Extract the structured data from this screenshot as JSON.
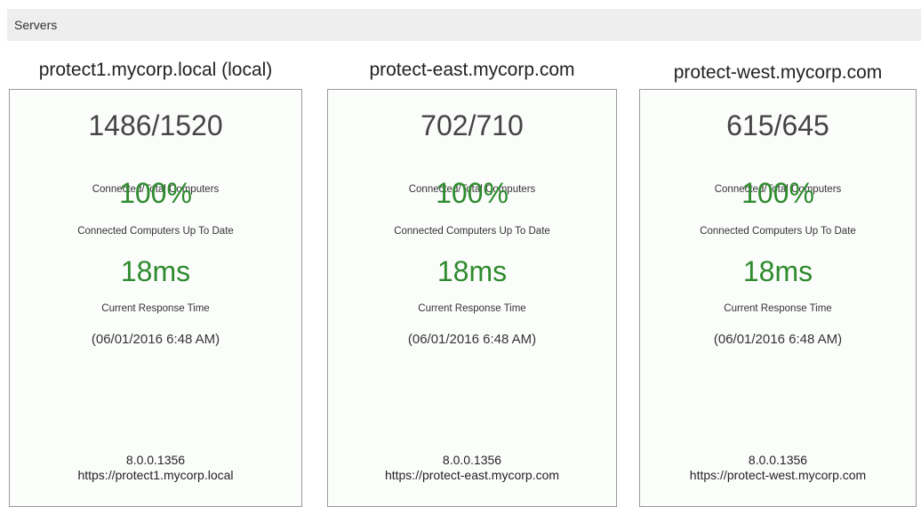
{
  "panel": {
    "title": "Servers"
  },
  "colors": {
    "metric_green": "#2e8b2e",
    "card_border": "#9a9a9a",
    "header_bg": "#eeeeee"
  },
  "servers": [
    {
      "name": "protect1.mycorp.local (local)",
      "connected_total": "1486/1520",
      "connected_total_label": "Connected/Total Computers",
      "up_to_date": "100%",
      "up_to_date_label": "Connected Computers Up To Date",
      "response_time": "18ms",
      "response_time_label": "Current Response Time",
      "timestamp": "(06/01/2016 6:48 AM)",
      "version": "8.0.0.1356",
      "url": "https://protect1.mycorp.local"
    },
    {
      "name": "protect-east.mycorp.com",
      "connected_total": "702/710",
      "connected_total_label": "Connected/Total Computers",
      "up_to_date": "100%",
      "up_to_date_label": "Connected Computers Up To Date",
      "response_time": "18ms",
      "response_time_label": "Current Response Time",
      "timestamp": "(06/01/2016 6:48 AM)",
      "version": "8.0.0.1356",
      "url": "https://protect-east.mycorp.com"
    },
    {
      "name": "protect-west.mycorp.com",
      "connected_total": "615/645",
      "connected_total_label": "Connected/Total Computers",
      "up_to_date": "100%",
      "up_to_date_label": "Connected Computers Up To Date",
      "response_time": "18ms",
      "response_time_label": "Current Response Time",
      "timestamp": "(06/01/2016 6:48 AM)",
      "version": "8.0.0.1356",
      "url": "https://protect-west.mycorp.com"
    }
  ]
}
